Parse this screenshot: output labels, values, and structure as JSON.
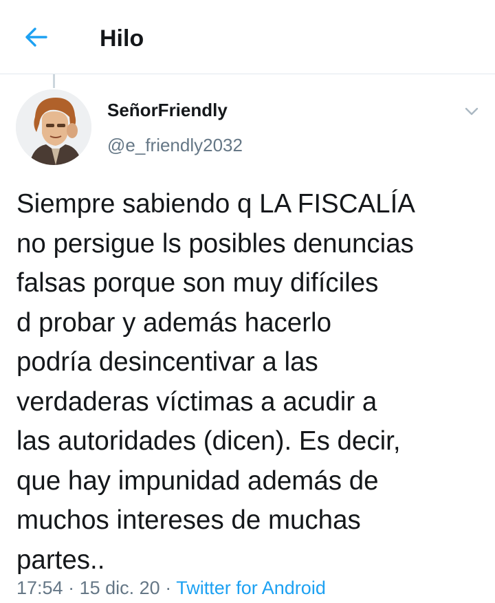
{
  "header": {
    "title": "Hilo",
    "back_icon": "arrow-left-icon",
    "accent_color": "#1da1f2"
  },
  "tweet": {
    "display_name": "SeñorFriendly",
    "handle": "@e_friendly2032",
    "avatar_icon": "user-avatar",
    "menu_icon": "chevron-down-icon",
    "text_lines": [
      "Siempre sabiendo q LA FISCALÍA",
      "no persigue ls posibles denuncias",
      "falsas porque son muy difíciles",
      "d probar y además hacerlo",
      "podría desincentivar a las",
      "verdaderas víctimas a acudir a",
      "las autoridades (dicen). Es decir,",
      "que hay impunidad además de",
      "muchos intereses de muchas",
      "partes.."
    ],
    "time": "17:54",
    "separator": "·",
    "date": "15 dic. 20",
    "source": "Twitter for Android"
  }
}
